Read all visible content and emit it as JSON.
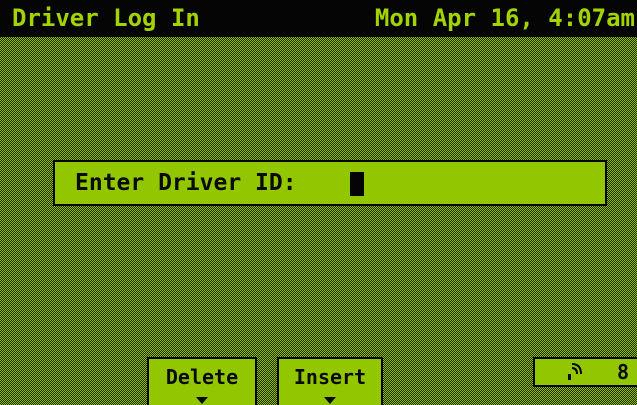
{
  "header": {
    "title": "Driver Log In",
    "datetime": "Mon Apr 16, 4:07am"
  },
  "form": {
    "prompt_label": "Enter Driver ID:",
    "driver_id_value": ""
  },
  "softkeys": [
    {
      "label": "Delete",
      "icon": "down-arrow-icon"
    },
    {
      "label": "Insert",
      "icon": "down-arrow-icon"
    }
  ],
  "status": {
    "icon": "signal-icon",
    "value": "8"
  },
  "colors": {
    "background_green": "#92c700",
    "dither_dark": "#1d2600",
    "title_bar_bg": "#050505",
    "title_text": "#a4d400"
  }
}
